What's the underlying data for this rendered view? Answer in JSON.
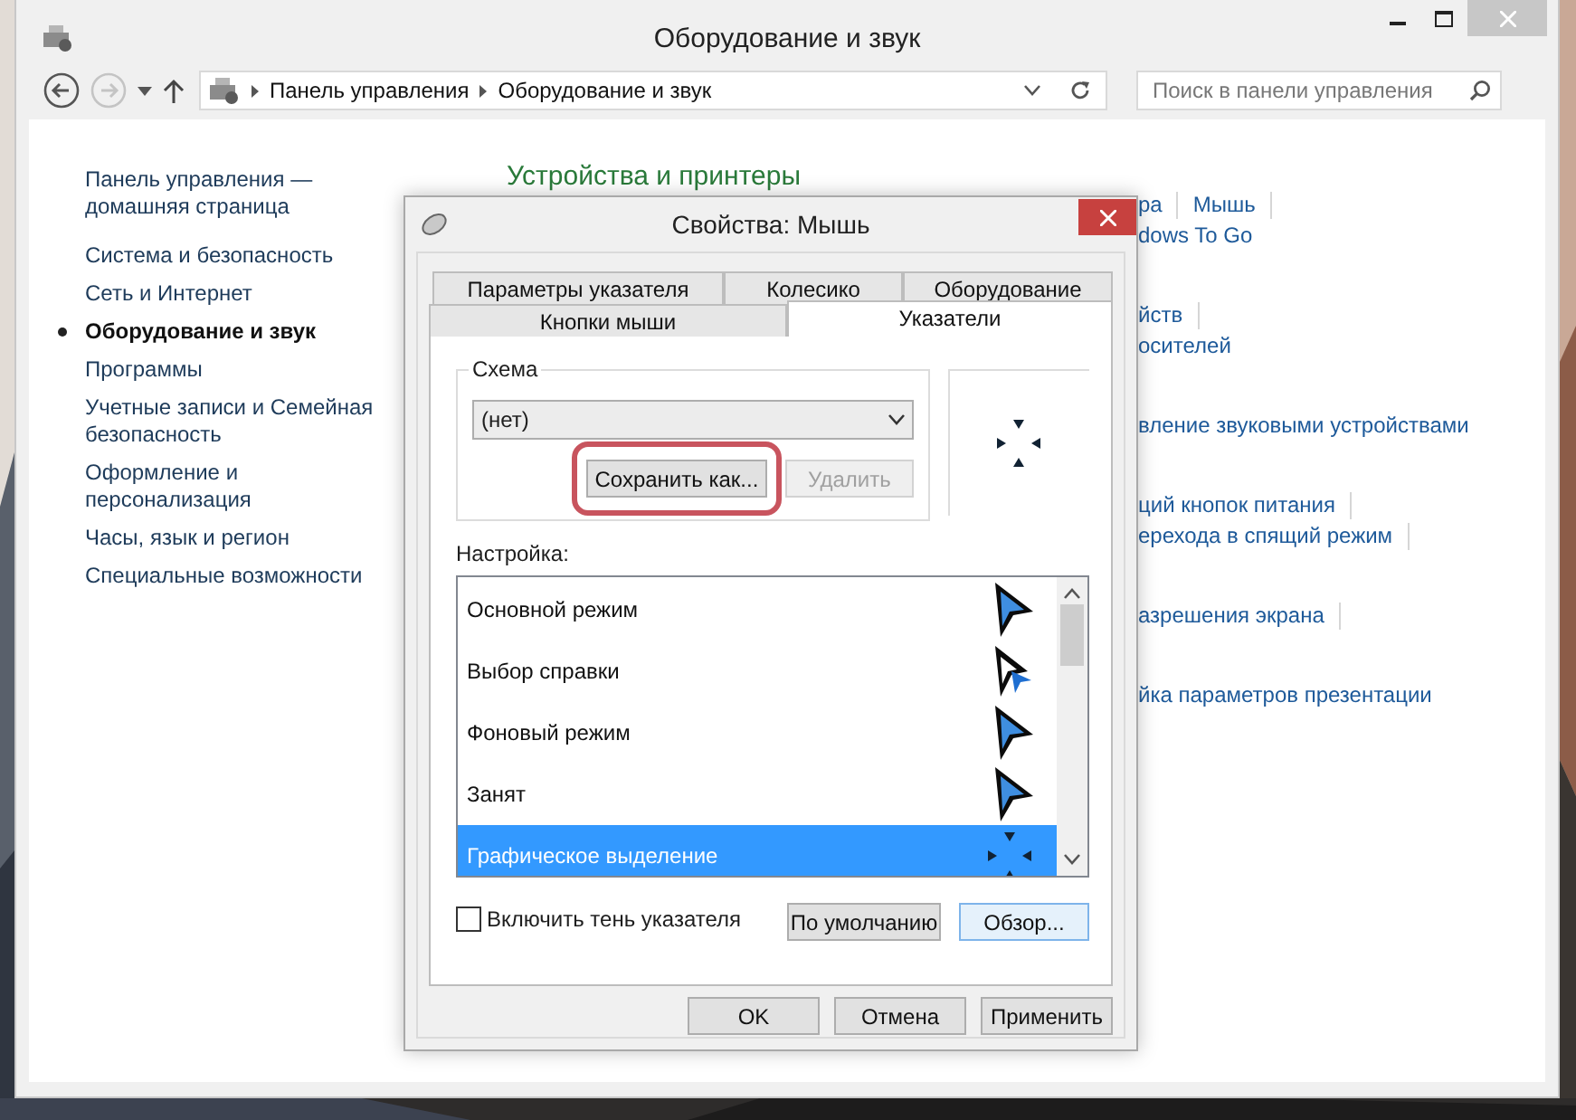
{
  "window": {
    "title": "Оборудование и звук"
  },
  "address_bar": {
    "path": [
      "Панель управления",
      "Оборудование и звук"
    ]
  },
  "search": {
    "placeholder": "Поиск в панели управления"
  },
  "sidebar": {
    "items": [
      {
        "label": "Панель управления — домашняя страница",
        "selected": false
      },
      {
        "label": "Система и безопасность",
        "selected": false
      },
      {
        "label": "Сеть и Интернет",
        "selected": false
      },
      {
        "label": "Оборудование и звук",
        "selected": true
      },
      {
        "label": "Программы",
        "selected": false
      },
      {
        "label": "Учетные записи и Семейная безопасность",
        "selected": false
      },
      {
        "label": "Оформление и персонализация",
        "selected": false
      },
      {
        "label": "Часы, язык и регион",
        "selected": false
      },
      {
        "label": "Специальные возможности",
        "selected": false
      }
    ]
  },
  "content": {
    "heading": "Устройства и принтеры",
    "sections": [
      {
        "rows": [
          {
            "links": [
              "ра",
              "Мышь"
            ],
            "divider": true
          },
          {
            "links": [
              "dows To Go"
            ],
            "divider": false
          }
        ]
      },
      {
        "rows": [
          {
            "links": [
              "йств"
            ],
            "divider": true
          },
          {
            "links": [
              "осителей"
            ],
            "divider": false
          }
        ]
      },
      {
        "rows": [
          {
            "links": [
              "вление звуковыми устройствами"
            ],
            "divider": false
          }
        ]
      },
      {
        "rows": [
          {
            "links": [
              "ций кнопок питания"
            ],
            "divider": true
          },
          {
            "links": [
              "ерехода в спящий режим"
            ],
            "divider": true
          }
        ]
      },
      {
        "rows": [
          {
            "links": [
              "азрешения экрана"
            ],
            "divider": true
          }
        ]
      },
      {
        "rows": [
          {
            "links": [
              "йка параметров презентации"
            ],
            "divider": false
          }
        ]
      }
    ]
  },
  "dialog": {
    "title": "Свойства: Мышь",
    "tab_rows": [
      [
        {
          "label": "Параметры указателя",
          "selected": false
        },
        {
          "label": "Колесико",
          "selected": false
        },
        {
          "label": "Оборудование",
          "selected": false
        }
      ],
      [
        {
          "label": "Кнопки мыши",
          "selected": false
        },
        {
          "label": "Указатели",
          "selected": true
        }
      ]
    ],
    "scheme": {
      "legend": "Схема",
      "value": "(нет)",
      "buttons": [
        {
          "label": "Сохранить как...",
          "disabled": false,
          "highlighted": true
        },
        {
          "label": "Удалить",
          "disabled": true,
          "highlighted": false
        }
      ]
    },
    "customize_label": "Настройка:",
    "cursors": [
      {
        "name": "Основной режим",
        "kind": "arrow",
        "selected": false
      },
      {
        "name": "Выбор справки",
        "kind": "help",
        "selected": false
      },
      {
        "name": "Фоновый режим",
        "kind": "arrow",
        "selected": false
      },
      {
        "name": "Занят",
        "kind": "arrow",
        "selected": false
      },
      {
        "name": "Графическое выделение",
        "kind": "crosshair",
        "selected": true
      }
    ],
    "shadow": {
      "label": "Включить тень указателя",
      "checked": false
    },
    "panel_buttons": [
      {
        "label": "По умолчанию",
        "focused": false
      },
      {
        "label": "Обзор...",
        "focused": true
      }
    ],
    "buttons": [
      "OK",
      "Отмена",
      "Применить"
    ]
  }
}
